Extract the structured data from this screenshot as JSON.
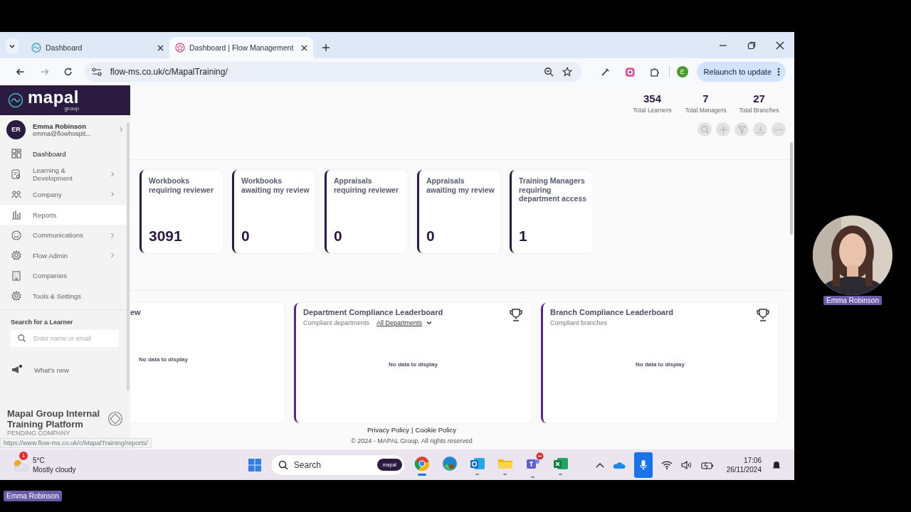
{
  "browser": {
    "tabs": [
      {
        "title": "Dashboard",
        "selected": false
      },
      {
        "title": "Dashboard | Flow Management",
        "selected": true
      }
    ],
    "address": "flow-ms.co.uk/c/MapalTraining/",
    "profile_initial": "E",
    "relaunch_button": "Relaunch to update"
  },
  "sidebar": {
    "logo": "mapal",
    "logo_sub": "group",
    "user": {
      "initials": "ER",
      "name": "Emma Robinson",
      "email": "emma@flowhospit..."
    },
    "items": [
      {
        "label": "Dashboard",
        "current": true,
        "highlighted": false,
        "has_submenu": false
      },
      {
        "label": "Learning & Development",
        "current": false,
        "highlighted": false,
        "has_submenu": true
      },
      {
        "label": "Company",
        "current": false,
        "highlighted": false,
        "has_submenu": true
      },
      {
        "label": "Reports",
        "current": false,
        "highlighted": true,
        "has_submenu": false
      },
      {
        "label": "Communications",
        "current": false,
        "highlighted": false,
        "has_submenu": true
      },
      {
        "label": "Flow Admin",
        "current": false,
        "highlighted": false,
        "has_submenu": true
      },
      {
        "label": "Companies",
        "current": false,
        "highlighted": false,
        "has_submenu": false
      },
      {
        "label": "Tools & Settings",
        "current": false,
        "highlighted": false,
        "has_submenu": false
      }
    ],
    "search": {
      "label": "Search for a Learner",
      "placeholder": "Enter name or email"
    },
    "whats_new": "What's new",
    "company": {
      "name": "Mapal Group Internal Training Platform",
      "status": "PENDING COMPANY"
    }
  },
  "stats": [
    {
      "value": "354",
      "label": "Total Learners"
    },
    {
      "value": "7",
      "label": "Total Managers"
    },
    {
      "value": "27",
      "label": "Total Branches"
    }
  ],
  "review_cards": [
    {
      "title": "Workbooks requiring reviewer",
      "value": "3091"
    },
    {
      "title": "Workbooks awaiting my review",
      "value": "0"
    },
    {
      "title": "Appraisals requiring reviewer",
      "value": "0"
    },
    {
      "title": "Appraisals awaiting my review",
      "value": "0"
    },
    {
      "title": "Training Managers requiring department access",
      "value": "1"
    }
  ],
  "leaderboards": [
    {
      "title": "ew",
      "empty_note": "No data to display"
    },
    {
      "title": "Department Compliance Leaderboard",
      "subtitle": "Compliant departments",
      "filter": "All Departments",
      "empty_note": "No data to display"
    },
    {
      "title": "Branch Compliance Leaderboard",
      "subtitle": "Compliant branches",
      "empty_note": "No data to display"
    }
  ],
  "footer": {
    "links": [
      "Privacy Policy",
      "Cookie Policy"
    ],
    "separator": "|",
    "copyright": "© 2024 - MAPAL Group. All rights reserved"
  },
  "status_url": "https://www.flow-ms.co.uk/c/MapalTraining/reports/",
  "taskbar": {
    "weather": {
      "badge": "1",
      "temperature": "5°C",
      "condition": "Mostly cloudy"
    },
    "search": "Search",
    "search_chip": "mapal",
    "time": "17:06",
    "date": "26/11/2024"
  },
  "webcam": {
    "name": "Emma Robinson"
  },
  "caption": "Emma Robinson"
}
